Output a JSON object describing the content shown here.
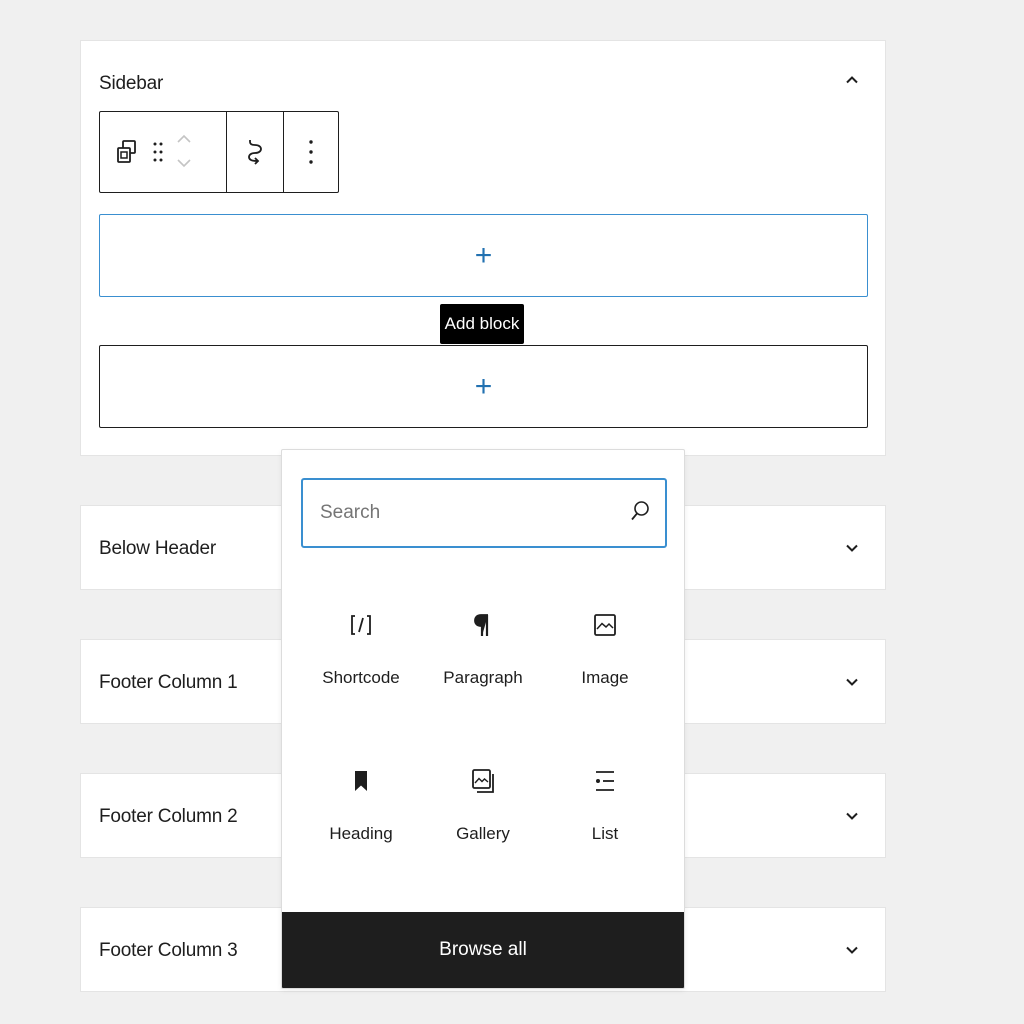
{
  "colors": {
    "accent": "#3a8fd0",
    "plus": "#2271b1",
    "dark": "#1e1e1e",
    "background": "#f0f0f0"
  },
  "panels": [
    {
      "title": "Sidebar",
      "expanded": true,
      "chevron": "chevron-up-icon"
    },
    {
      "title": "Below Header",
      "expanded": false,
      "chevron": "chevron-down-icon"
    },
    {
      "title": "Footer Column 1",
      "expanded": false,
      "chevron": "chevron-down-icon"
    },
    {
      "title": "Footer Column 2",
      "expanded": false,
      "chevron": "chevron-down-icon"
    },
    {
      "title": "Footer Column 3",
      "expanded": false,
      "chevron": "chevron-down-icon"
    }
  ],
  "toolbar": {
    "icons": [
      "widget-block-icon",
      "drag-handle-icon",
      "move-up-icon",
      "move-down-icon",
      "transform-icon",
      "more-options-icon"
    ]
  },
  "appenders": [
    {
      "icon": "plus-icon",
      "symbol": "+"
    },
    {
      "icon": "plus-icon",
      "symbol": "+"
    }
  ],
  "tooltip": {
    "text": "Add block"
  },
  "inserter": {
    "search": {
      "placeholder": "Search",
      "value": "",
      "icon": "search-icon"
    },
    "blocks": [
      {
        "label": "Shortcode",
        "icon": "shortcode-icon"
      },
      {
        "label": "Paragraph",
        "icon": "paragraph-icon"
      },
      {
        "label": "Image",
        "icon": "image-icon"
      },
      {
        "label": "Heading",
        "icon": "heading-icon"
      },
      {
        "label": "Gallery",
        "icon": "gallery-icon"
      },
      {
        "label": "List",
        "icon": "list-icon"
      }
    ],
    "browse_all": "Browse all"
  }
}
